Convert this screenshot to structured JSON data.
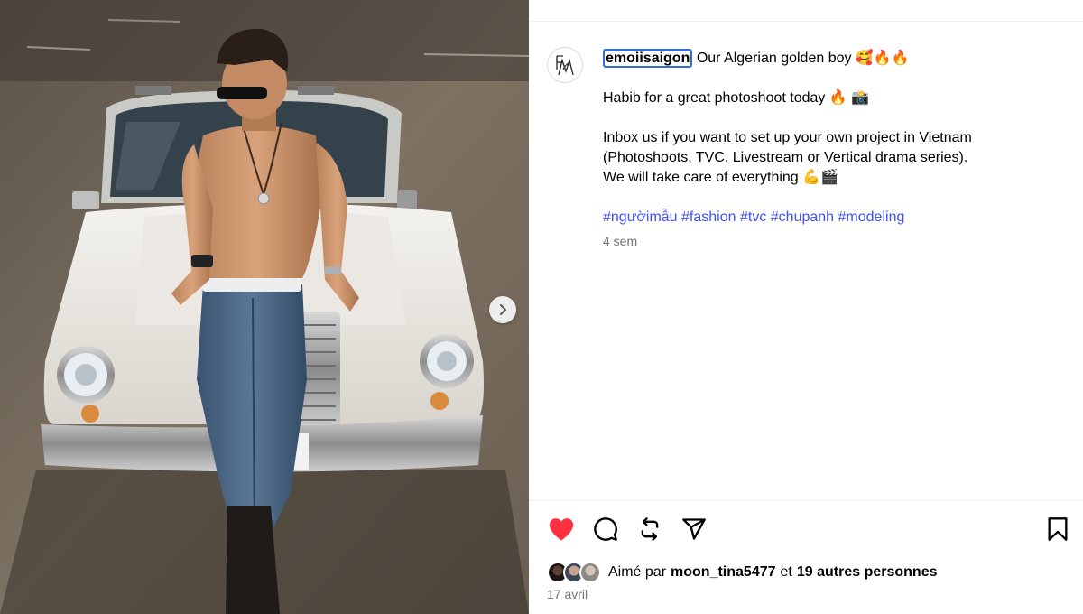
{
  "post": {
    "username": "emoiisaigon",
    "caption_line1": "Our Algerian golden boy 🥰🔥🔥",
    "caption_line2": "Habib for a great photoshoot today 🔥 📸",
    "caption_line3": "Inbox us if you want to set up your own project in Vietnam",
    "caption_line4": "(Photoshoots, TVC, Livestream or Vertical drama series).",
    "caption_line5": "We will take care of everything 💪🎬",
    "hashtags": [
      "#ngườimẫu",
      "#fashion",
      "#tvc",
      "#chupanh",
      "#modeling"
    ],
    "time_ago": "4 sem"
  },
  "likes": {
    "prefix": "Aimé par",
    "user": "moon_tina5477",
    "joiner": "et",
    "others": "19 autres personnes"
  },
  "date": "17 avril",
  "icons": {
    "like": "heart-filled-icon",
    "comment": "comment-icon",
    "repost": "repost-icon",
    "share": "share-icon",
    "save": "bookmark-icon",
    "next": "chevron-right-icon"
  },
  "colors": {
    "like_red": "#ff3040",
    "hashtag_blue": "#4150f7",
    "focus_outline": "#2f6fde",
    "muted_text": "#737373"
  }
}
